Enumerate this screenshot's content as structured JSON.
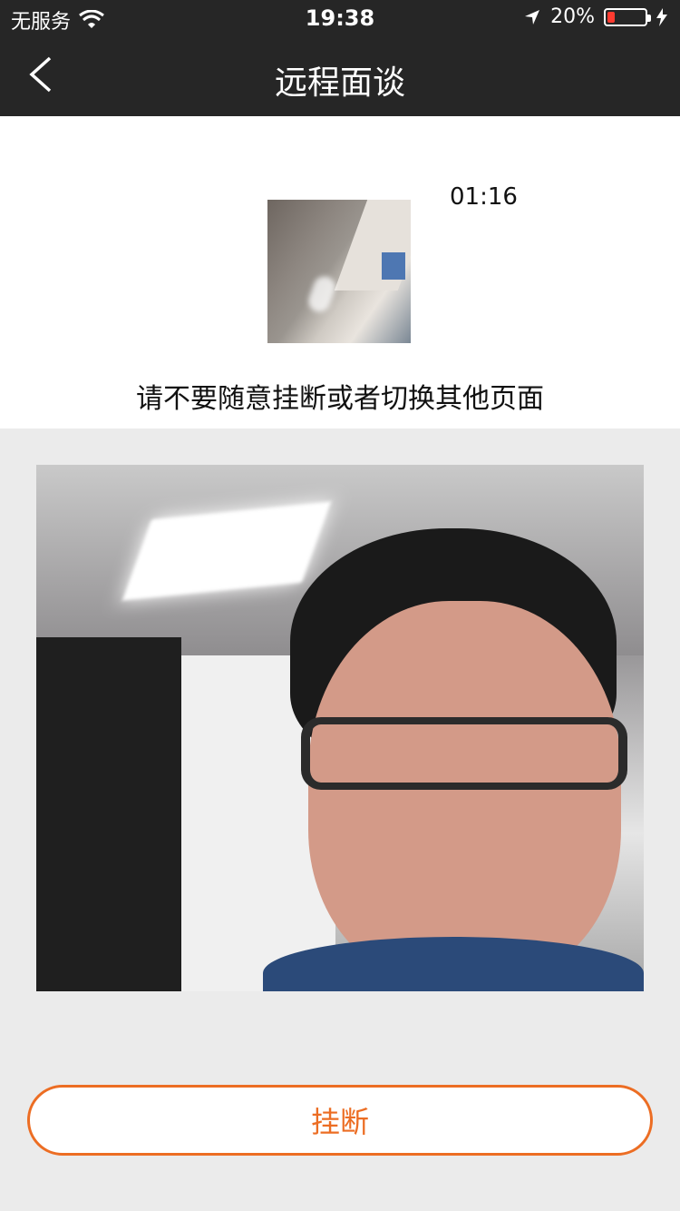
{
  "status_bar": {
    "carrier": "无服务",
    "time": "19:38",
    "battery_percent": "20%",
    "battery_level": 0.2,
    "battery_color": "#ff3b30"
  },
  "nav": {
    "back_icon": "chevron-left-icon",
    "title": "远程面谈"
  },
  "call": {
    "timer": "01:16",
    "notice": "请不要随意挂断或者切换其他页面"
  },
  "actions": {
    "hangup_label": "挂断",
    "accent_color": "#ec6d23"
  }
}
